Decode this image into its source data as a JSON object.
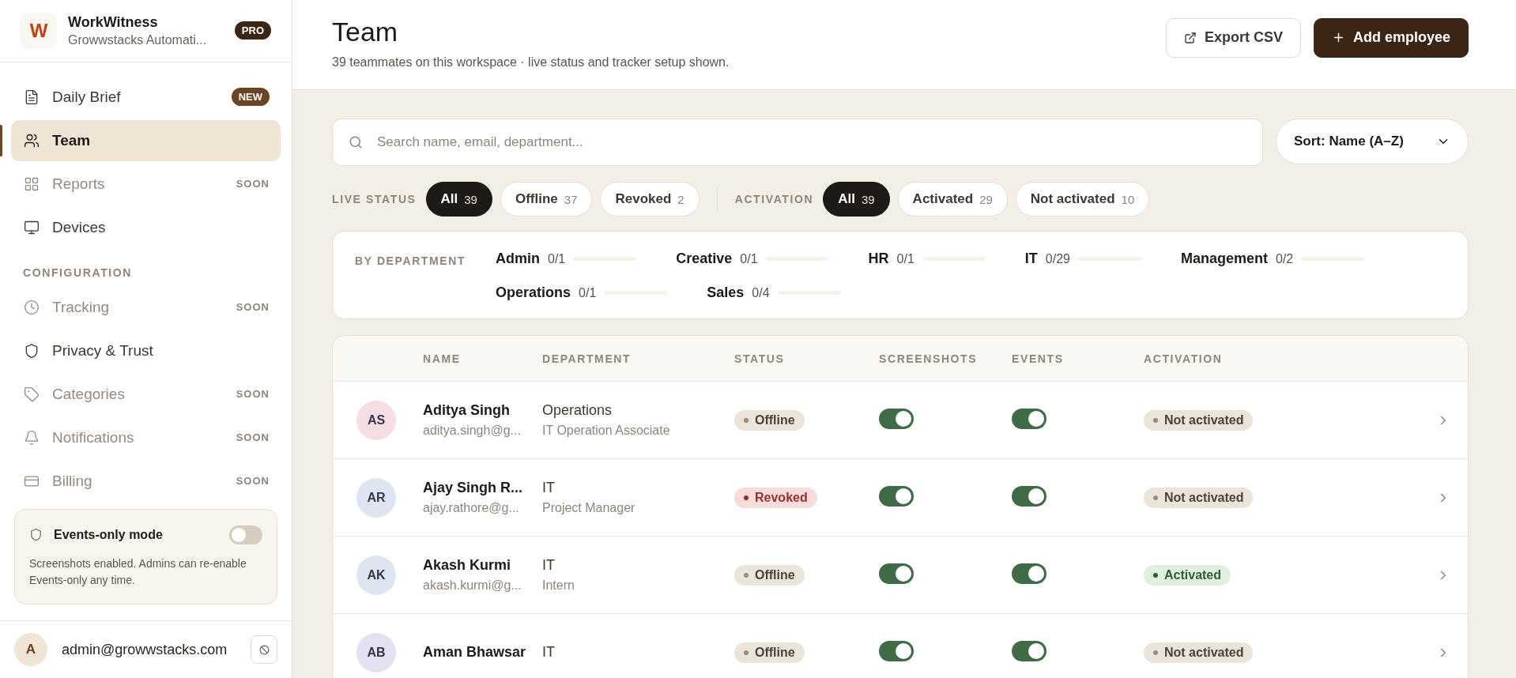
{
  "brand": {
    "logo": "W",
    "name": "WorkWitness",
    "org": "Growwstacks Automati...",
    "plan": "PRO"
  },
  "nav": [
    {
      "label": "Daily Brief",
      "badge": "NEW",
      "kind": "new",
      "selected": false,
      "disabled": false
    },
    {
      "label": "Team",
      "selected": true,
      "disabled": false
    },
    {
      "label": "Reports",
      "badge": "SOON",
      "kind": "soon",
      "selected": false,
      "disabled": true
    },
    {
      "label": "Devices",
      "selected": false,
      "disabled": false
    }
  ],
  "config_heading": "CONFIGURATION",
  "config": [
    {
      "label": "Tracking",
      "badge": "SOON",
      "kind": "soon",
      "selected": false,
      "disabled": true
    },
    {
      "label": "Privacy & Trust",
      "selected": false,
      "disabled": false
    },
    {
      "label": "Categories",
      "badge": "SOON",
      "kind": "soon",
      "selected": false,
      "disabled": true
    },
    {
      "label": "Notifications",
      "badge": "SOON",
      "kind": "soon",
      "selected": false,
      "disabled": true
    },
    {
      "label": "Billing",
      "badge": "SOON",
      "kind": "soon",
      "selected": false,
      "disabled": true
    }
  ],
  "events_mode": {
    "title": "Events-only mode",
    "on": false,
    "description": "Screenshots enabled. Admins can re-enable Events-only any time."
  },
  "user": {
    "initial": "A",
    "email": "admin@growwstacks.com"
  },
  "header": {
    "title": "Team",
    "subtitle": "39 teammates on this workspace · live status and tracker setup shown.",
    "export_label": "Export CSV",
    "add_label": "Add employee"
  },
  "search": {
    "placeholder": "Search name, email, department..."
  },
  "sort": {
    "label": "Sort: Name (A–Z)"
  },
  "filters": [
    {
      "label": "LIVE STATUS",
      "chips": [
        {
          "label": "All",
          "count": "39",
          "selected": true
        },
        {
          "label": "Offline",
          "count": "37",
          "selected": false
        },
        {
          "label": "Revoked",
          "count": "2",
          "selected": false
        }
      ]
    },
    {
      "label": "ACTIVATION",
      "chips": [
        {
          "label": "All",
          "count": "39",
          "selected": true
        },
        {
          "label": "Activated",
          "count": "29",
          "selected": false
        },
        {
          "label": "Not activated",
          "count": "10",
          "selected": false
        }
      ]
    }
  ],
  "departments": {
    "label": "BY DEPARTMENT",
    "items": [
      {
        "name": "Admin",
        "count": "0/1",
        "level": 0
      },
      {
        "name": "Creative",
        "count": "0/1",
        "level": 0
      },
      {
        "name": "HR",
        "count": "0/1",
        "level": 0
      },
      {
        "name": "IT",
        "count": "0/29",
        "level": 0
      },
      {
        "name": "Management",
        "count": "0/2",
        "level": 0
      },
      {
        "name": "Operations",
        "count": "0/1",
        "level": 0
      },
      {
        "name": "Sales",
        "count": "0/4",
        "level": 0
      }
    ]
  },
  "table": {
    "columns": [
      "NAME",
      "DEPARTMENT",
      "STATUS",
      "SCREENSHOTS",
      "EVENTS",
      "ACTIVATION"
    ],
    "rows": [
      {
        "initials": "AS",
        "color": "#f5dde2",
        "name": "Aditya Singh",
        "email": "aditya.singh@g...",
        "department": "Operations",
        "role": "IT Operation Associate",
        "status": "Offline",
        "kind": "offline",
        "screenshots": true,
        "events": true,
        "activation": "Not activated",
        "activated": false
      },
      {
        "initials": "AR",
        "color": "#dde6f0",
        "name": "Ajay Singh R...",
        "email": "ajay.rathore@g...",
        "department": "IT",
        "role": "Project Manager",
        "status": "Revoked",
        "kind": "revoked",
        "screenshots": true,
        "events": true,
        "activation": "Not activated",
        "activated": false
      },
      {
        "initials": "AK",
        "color": "#dde6f0",
        "name": "Akash Kurmi",
        "email": "akash.kurmi@g...",
        "department": "IT",
        "role": "Intern",
        "status": "Offline",
        "kind": "offline",
        "screenshots": true,
        "events": true,
        "activation": "Activated",
        "activated": true
      },
      {
        "initials": "AB",
        "color": "#e3e0f2",
        "name": "Aman Bhawsar",
        "department": "IT",
        "status": "Offline",
        "kind": "offline",
        "screenshots": true,
        "events": true,
        "activation": "Not activated",
        "activated": false
      }
    ]
  }
}
